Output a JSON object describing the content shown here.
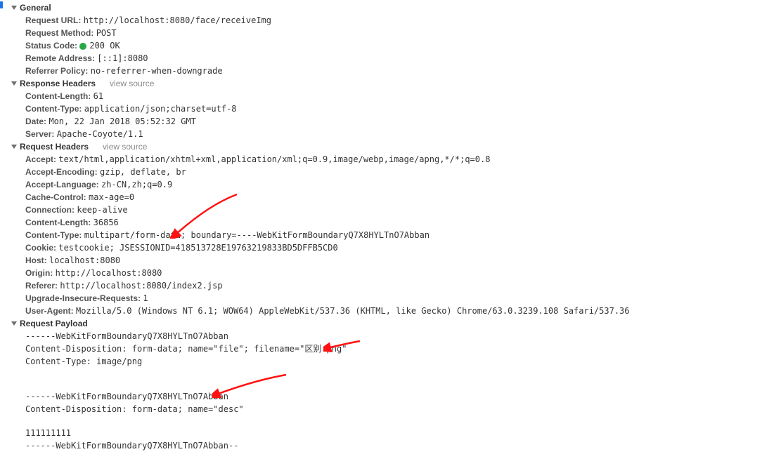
{
  "sections": {
    "general": {
      "title": "General",
      "request_url_k": "Request URL:",
      "request_url_v": "http://localhost:8080/face/receiveImg",
      "request_method_k": "Request Method:",
      "request_method_v": "POST",
      "status_code_k": "Status Code:",
      "status_code_v": "200 OK",
      "remote_addr_k": "Remote Address:",
      "remote_addr_v": "[::1]:8080",
      "referrer_policy_k": "Referrer Policy:",
      "referrer_policy_v": "no-referrer-when-downgrade"
    },
    "response_headers": {
      "title": "Response Headers",
      "view_source": "view source",
      "content_length_k": "Content-Length:",
      "content_length_v": "61",
      "content_type_k": "Content-Type:",
      "content_type_v": "application/json;charset=utf-8",
      "date_k": "Date:",
      "date_v": "Mon, 22 Jan 2018 05:52:32 GMT",
      "server_k": "Server:",
      "server_v": "Apache-Coyote/1.1"
    },
    "request_headers": {
      "title": "Request Headers",
      "view_source": "view source",
      "accept_k": "Accept:",
      "accept_v": "text/html,application/xhtml+xml,application/xml;q=0.9,image/webp,image/apng,*/*;q=0.8",
      "accept_encoding_k": "Accept-Encoding:",
      "accept_encoding_v": "gzip, deflate, br",
      "accept_language_k": "Accept-Language:",
      "accept_language_v": "zh-CN,zh;q=0.9",
      "cache_control_k": "Cache-Control:",
      "cache_control_v": "max-age=0",
      "connection_k": "Connection:",
      "connection_v": "keep-alive",
      "content_length_k": "Content-Length:",
      "content_length_v": "36856",
      "content_type_k": "Content-Type:",
      "content_type_v": "multipart/form-data; boundary=----WebKitFormBoundaryQ7X8HYLTnO7Abban",
      "cookie_k": "Cookie:",
      "cookie_v": "testcookie; JSESSIONID=418513728E19763219833BD5DFFB5CD0",
      "host_k": "Host:",
      "host_v": "localhost:8080",
      "origin_k": "Origin:",
      "origin_v": "http://localhost:8080",
      "referer_k": "Referer:",
      "referer_v": "http://localhost:8080/index2.jsp",
      "upgrade_insecure_k": "Upgrade-Insecure-Requests:",
      "upgrade_insecure_v": "1",
      "user_agent_k": "User-Agent:",
      "user_agent_v": "Mozilla/5.0 (Windows NT 6.1; WOW64) AppleWebKit/537.36 (KHTML, like Gecko) Chrome/63.0.3239.108 Safari/537.36"
    },
    "request_payload": {
      "title": "Request Payload",
      "line1": "------WebKitFormBoundaryQ7X8HYLTnO7Abban",
      "line2": "Content-Disposition: form-data; name=\"file\"; filename=\"区别.png\"",
      "line3": "Content-Type: image/png",
      "line4": "",
      "line5": "",
      "line6": "------WebKitFormBoundaryQ7X8HYLTnO7Abban",
      "line7": "Content-Disposition: form-data; name=\"desc\"",
      "line8": "",
      "line9": "111111111",
      "line10": "------WebKitFormBoundaryQ7X8HYLTnO7Abban--"
    }
  }
}
